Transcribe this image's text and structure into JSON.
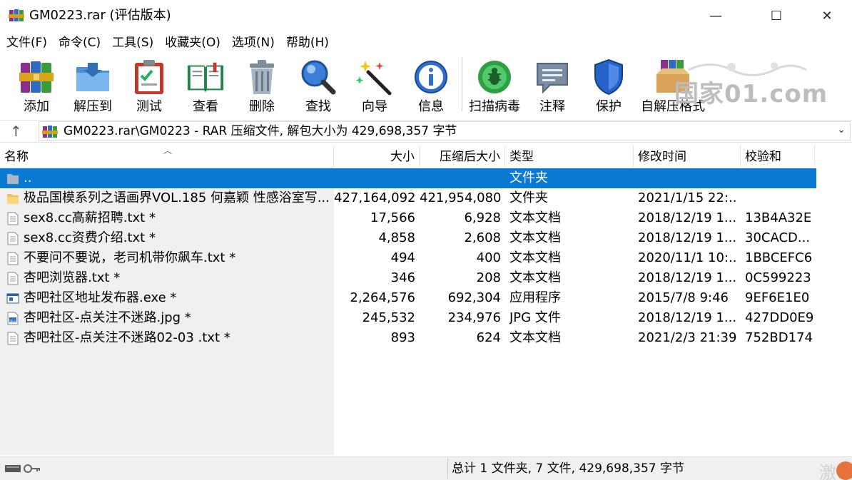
{
  "window": {
    "title": "GM0223.rar (评估版本)",
    "minimize_glyph": "—",
    "maximize_glyph": "☐",
    "close_glyph": "✕"
  },
  "menu": [
    "文件(F)",
    "命令(C)",
    "工具(S)",
    "收藏夹(O)",
    "选项(N)",
    "帮助(H)"
  ],
  "toolbar": {
    "buttons": [
      {
        "label": "添加",
        "icon": "books-add-icon"
      },
      {
        "label": "解压到",
        "icon": "folder-extract-icon"
      },
      {
        "label": "测试",
        "icon": "clipboard-check-icon"
      },
      {
        "label": "查看",
        "icon": "open-book-icon"
      },
      {
        "label": "删除",
        "icon": "trash-can-icon"
      },
      {
        "label": "查找",
        "icon": "magnifier-icon"
      },
      {
        "label": "向导",
        "icon": "magic-wand-icon"
      },
      {
        "label": "信息",
        "icon": "info-icon"
      },
      {
        "label": "扫描病毒",
        "icon": "virus-scan-icon"
      },
      {
        "label": "注释",
        "icon": "comment-icon"
      },
      {
        "label": "保护",
        "icon": "shield-icon"
      },
      {
        "label": "自解压格式",
        "icon": "sfx-box-icon"
      }
    ],
    "watermark": "国家01.com"
  },
  "address": {
    "up_glyph": "↑",
    "path": "GM0223.rar\\GM0223 - RAR 压缩文件, 解包大小为 429,698,357 字节",
    "chevron": "⌄"
  },
  "columns": {
    "name": "名称",
    "size": "大小",
    "packed": "压缩后大小",
    "type": "类型",
    "modified": "修改时间",
    "crc": "校验和"
  },
  "files": [
    {
      "name": "..",
      "size": "",
      "packed": "",
      "type": "文件夹",
      "modified": "",
      "crc": "",
      "icon": "folder-icon",
      "selected": true
    },
    {
      "name": "极品国模系列之语画界VOL.185 何嘉颖 性感浴室写...",
      "size": "427,164,092",
      "packed": "421,954,080",
      "type": "文件夹",
      "modified": "2021/1/15 22:...",
      "crc": "",
      "icon": "folder-icon",
      "selected": false
    },
    {
      "name": "sex8.cc高薪招聘.txt *",
      "size": "17,566",
      "packed": "6,928",
      "type": "文本文档",
      "modified": "2018/12/19 1...",
      "crc": "13B4A32E",
      "icon": "text-file-icon",
      "selected": false
    },
    {
      "name": "sex8.cc资费介绍.txt *",
      "size": "4,858",
      "packed": "2,608",
      "type": "文本文档",
      "modified": "2018/12/19 1...",
      "crc": "30CACD...",
      "icon": "text-file-icon",
      "selected": false
    },
    {
      "name": "不要问不要说，老司机带你飙车.txt *",
      "size": "494",
      "packed": "400",
      "type": "文本文档",
      "modified": "2020/11/1 10:...",
      "crc": "1BBCEFC6",
      "icon": "text-file-icon",
      "selected": false
    },
    {
      "name": "杏吧浏览器.txt *",
      "size": "346",
      "packed": "208",
      "type": "文本文档",
      "modified": "2018/12/19 1...",
      "crc": "0C599223",
      "icon": "text-file-icon",
      "selected": false
    },
    {
      "name": "杏吧社区地址发布器.exe *",
      "size": "2,264,576",
      "packed": "692,304",
      "type": "应用程序",
      "modified": "2015/7/8 9:46",
      "crc": "9EF6E1E0",
      "icon": "exe-file-icon",
      "selected": false
    },
    {
      "name": "杏吧社区-点关注不迷路.jpg *",
      "size": "245,532",
      "packed": "234,976",
      "type": "JPG 文件",
      "modified": "2018/12/19 1...",
      "crc": "427DD0E9",
      "icon": "image-file-icon",
      "selected": false
    },
    {
      "name": "杏吧社区-点关注不迷路02-03 .txt *",
      "size": "893",
      "packed": "624",
      "type": "文本文档",
      "modified": "2021/2/3 21:39",
      "crc": "752BD174",
      "icon": "text-file-icon",
      "selected": false
    }
  ],
  "status": {
    "summary": "总计 1 文件夹, 7 文件, 429,698,357 字节",
    "corner_char": "激"
  },
  "colors": {
    "selection": "#0a79d2",
    "name_column_bg": "#f0f0f0",
    "statusbar_bg": "#f0f0f0"
  }
}
